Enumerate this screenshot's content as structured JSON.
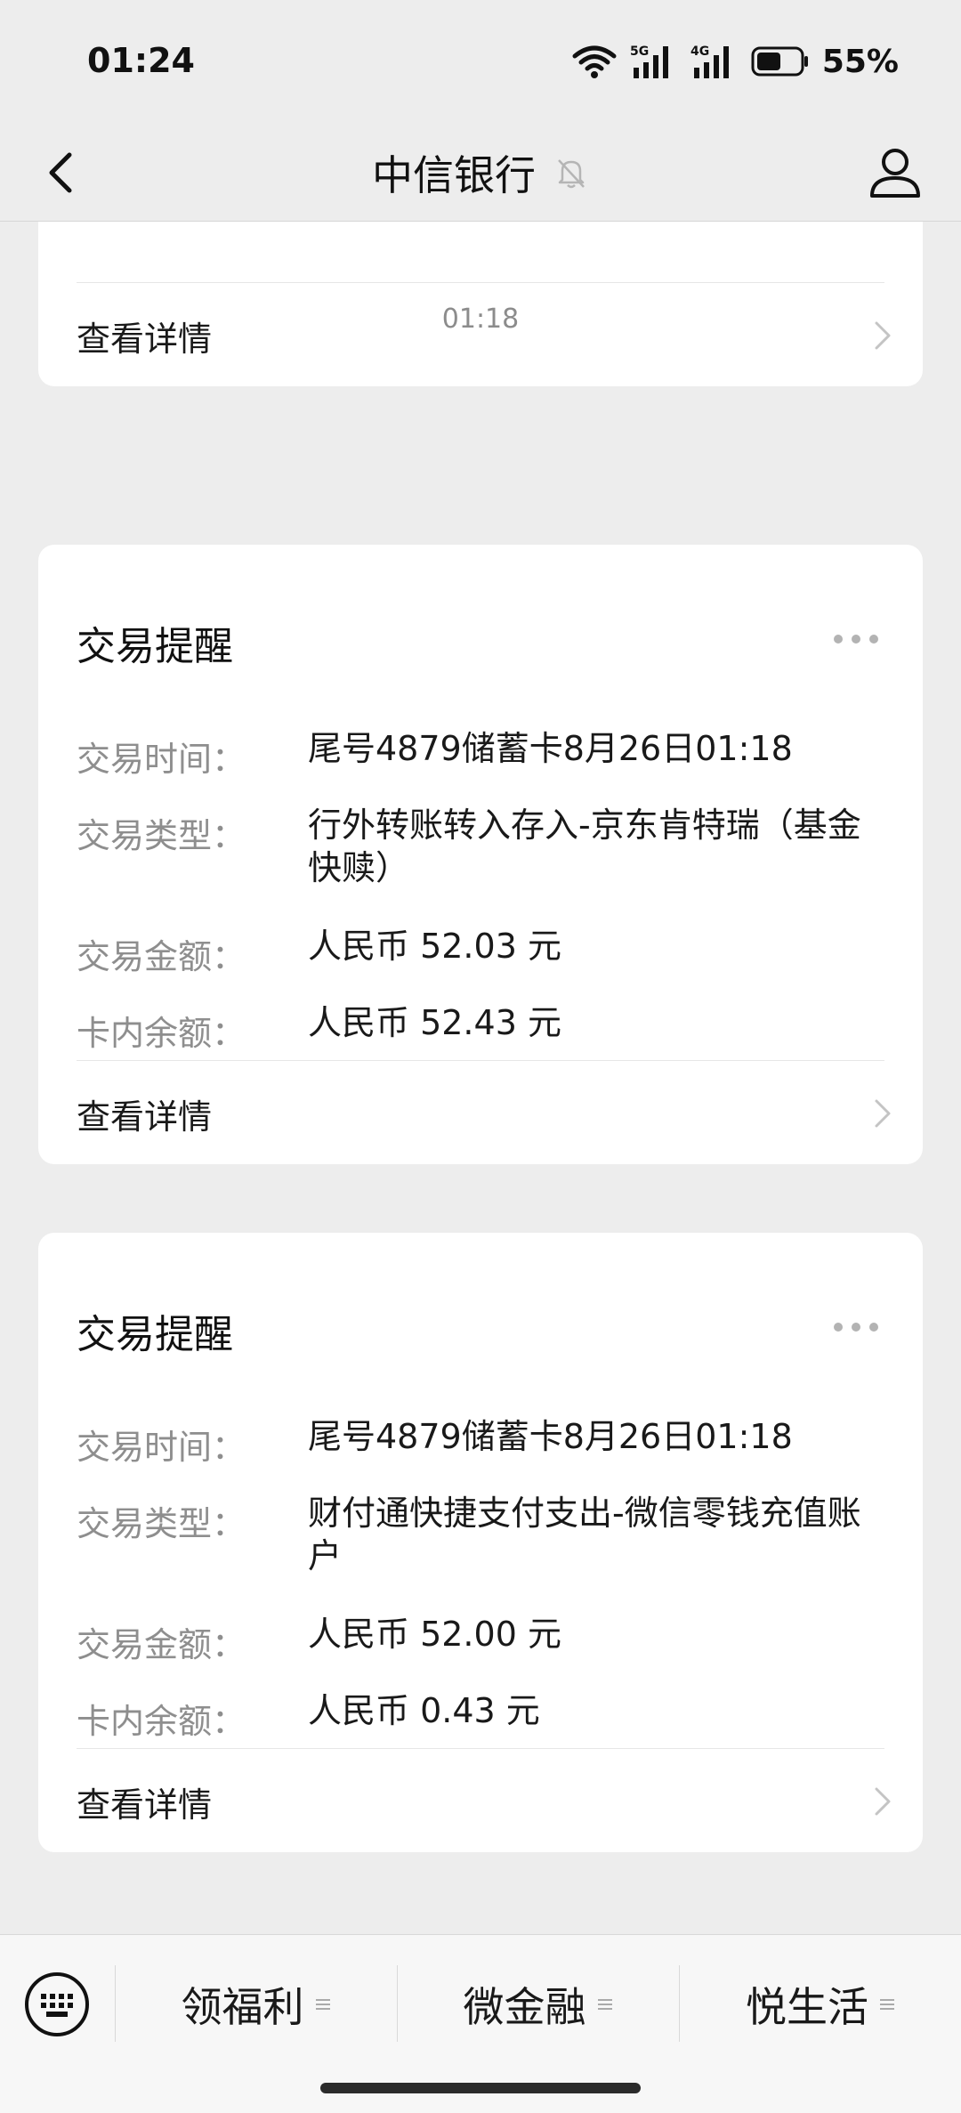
{
  "status_bar": {
    "time": "01:24",
    "battery": "55%"
  },
  "nav": {
    "title": "中信银行"
  },
  "partial_card": {
    "detail_label": "查看详情"
  },
  "timestamp": "01:18",
  "cards": [
    {
      "title": "交易提醒",
      "fields": [
        {
          "label": "交易时间：",
          "value": "尾号4879储蓄卡8月26日01:18"
        },
        {
          "label": "交易类型：",
          "value": "行外转账转入存入-京东肯特瑞（基金快赎）"
        },
        {
          "label": "交易金额：",
          "value": "人民币 52.03 元"
        },
        {
          "label": "卡内余额：",
          "value": "人民币 52.43 元"
        }
      ],
      "detail_label": "查看详情"
    },
    {
      "title": "交易提醒",
      "fields": [
        {
          "label": "交易时间：",
          "value": "尾号4879储蓄卡8月26日01:18"
        },
        {
          "label": "交易类型：",
          "value": "财付通快捷支付支出-微信零钱充值账户"
        },
        {
          "label": "交易金额：",
          "value": "人民币 52.00 元"
        },
        {
          "label": "卡内余额：",
          "value": "人民币 0.43 元"
        }
      ],
      "detail_label": "查看详情"
    }
  ],
  "bottom_menu": {
    "items": [
      {
        "label": "领福利"
      },
      {
        "label": "微金融"
      },
      {
        "label": "悦生活"
      }
    ]
  }
}
